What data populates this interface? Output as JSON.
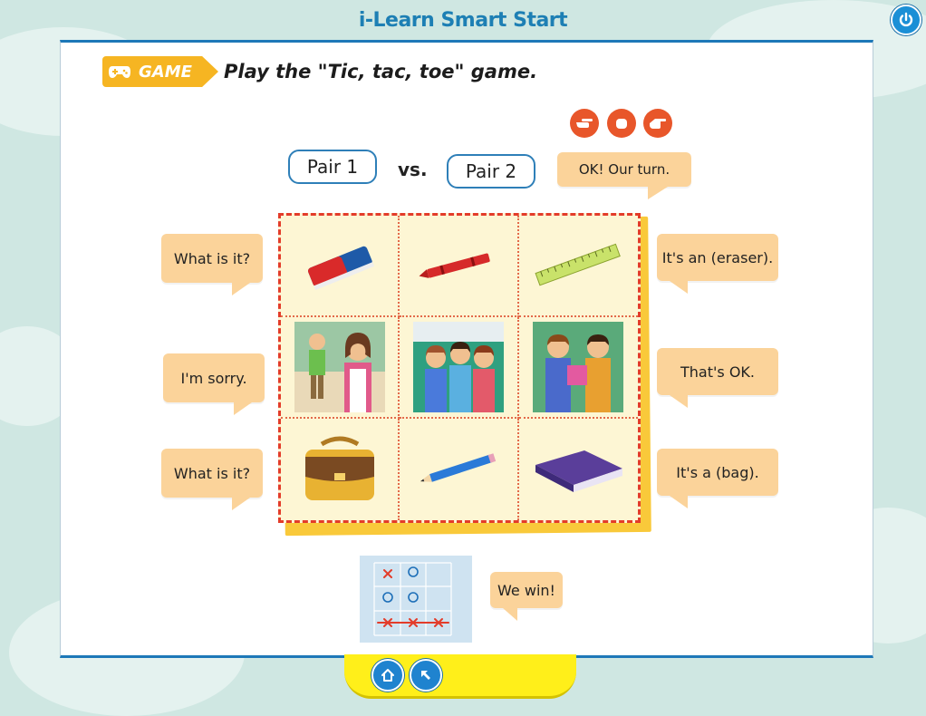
{
  "app": {
    "title": "i-Learn Smart Start"
  },
  "activity": {
    "badge": "GAME",
    "instruction": "Play the \"Tic, tac, toe\" game."
  },
  "teams": {
    "pair1": "Pair 1",
    "vs": "vs.",
    "pair2": "Pair 2"
  },
  "bubbles": {
    "our_turn": "OK! Our turn.",
    "left": [
      "What is it?",
      "I'm sorry.",
      "What is it?"
    ],
    "right": [
      "It's an (eraser).",
      "That's OK.",
      "It's a (bag)."
    ],
    "we_win": "We win!"
  },
  "grid_cells": [
    "eraser",
    "crayon",
    "ruler",
    "boy-and-mother",
    "three-children",
    "two-boys-sharing",
    "bag",
    "pencil",
    "book"
  ],
  "mini_board": [
    [
      "x",
      "o",
      ""
    ],
    [
      "o",
      "o",
      ""
    ],
    [
      "x",
      "x",
      "x"
    ]
  ],
  "colors": {
    "bubble": "#fbd39a",
    "accent": "#1d78b8",
    "grid_border": "#e33c2a",
    "badge": "#f6b522"
  },
  "icons": [
    "power-icon",
    "game-controller-icon",
    "hand-scissors-icon",
    "hand-rock-icon",
    "hand-paper-icon",
    "home-icon",
    "back-arrow-icon"
  ]
}
